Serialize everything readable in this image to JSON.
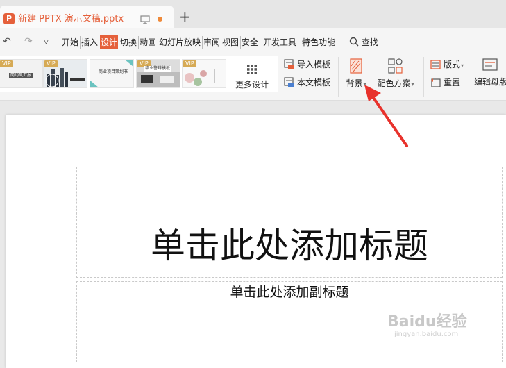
{
  "app": {
    "doc_title": "新建 PPTX 演示文稿.pptx",
    "app_icon_letter": "P",
    "new_tab": "+",
    "accent": "#e5603b"
  },
  "quick_access": {
    "undo": "↶",
    "redo": "↷",
    "more": "▿"
  },
  "menu": {
    "items": [
      "开始",
      "插入",
      "设计",
      "切换",
      "动画",
      "幻灯片放映",
      "审阅",
      "视图",
      "安全",
      "开发工具",
      "特色功能"
    ],
    "active": "设计",
    "search": "查找"
  },
  "ribbon": {
    "thumbnails": [
      {
        "vip": "VIP",
        "caption": "简约风汇报"
      },
      {
        "vip": "VIP",
        "caption": ""
      },
      {
        "vip": "",
        "caption": "商业项目策划书"
      },
      {
        "vip": "VIP",
        "caption": "毕业答辩模板"
      },
      {
        "vip": "VIP",
        "caption": ""
      }
    ],
    "more_design": "更多设计",
    "import_template": "导入模板",
    "this_template": "本文模板",
    "background": "背景",
    "color_scheme": "配色方案",
    "layout": "版式",
    "reset": "重置",
    "edit_master": "编辑母版"
  },
  "slide": {
    "title_placeholder": "单击此处添加标题",
    "subtitle_placeholder": "单击此处添加副标题"
  },
  "watermark": {
    "text": "Baidu经验",
    "url": "jingyan.baidu.com"
  }
}
